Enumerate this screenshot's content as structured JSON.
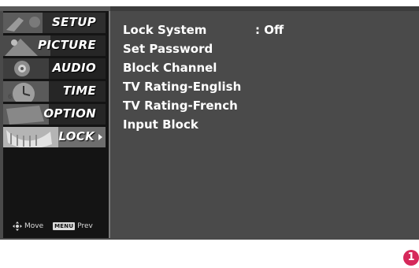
{
  "menu": {
    "items": [
      {
        "label": "SETUP"
      },
      {
        "label": "PICTURE"
      },
      {
        "label": "AUDIO"
      },
      {
        "label": "TIME"
      },
      {
        "label": "OPTION"
      },
      {
        "label": "LOCK"
      }
    ],
    "active_index": 5
  },
  "footer": {
    "move_label": "Move",
    "menu_key": "MENU",
    "prev_label": "Prev"
  },
  "lock_menu": {
    "options": [
      {
        "label": "Lock System",
        "value": ": Off"
      },
      {
        "label": "Set Password",
        "value": ""
      },
      {
        "label": "Block Channel",
        "value": ""
      },
      {
        "label": "TV Rating-English",
        "value": ""
      },
      {
        "label": "TV Rating-French",
        "value": ""
      },
      {
        "label": "Input Block",
        "value": ""
      }
    ]
  },
  "step_badge": "1",
  "colors": {
    "screen_bg": "#4a4a4a",
    "sidebar_bg": "#141414",
    "text": "#ffffff",
    "badge": "#d6285a"
  }
}
